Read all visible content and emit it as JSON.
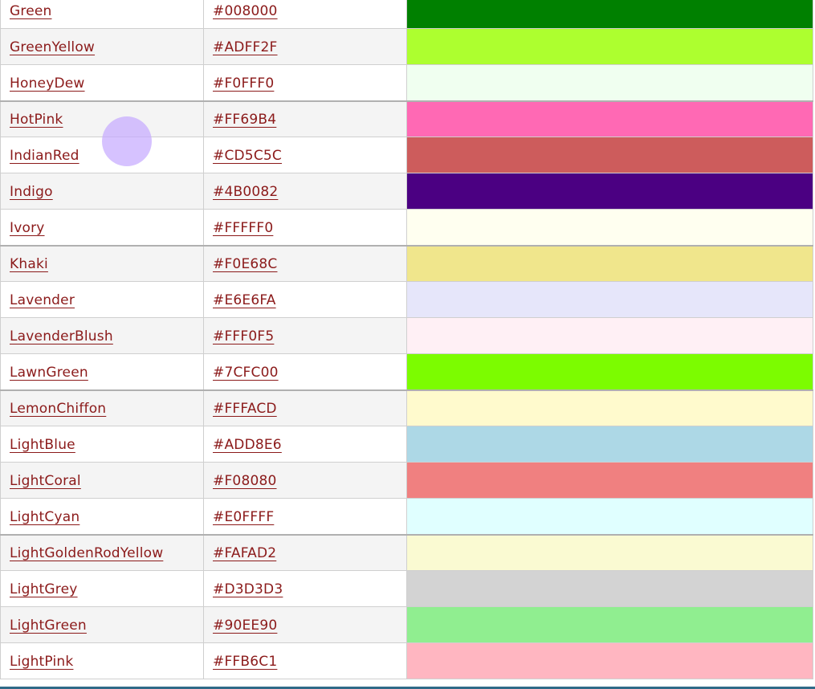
{
  "rows": [
    {
      "name": "Green",
      "hex": "#008000",
      "swatch": "#008000"
    },
    {
      "name": "GreenYellow",
      "hex": "#ADFF2F",
      "swatch": "#ADFF2F"
    },
    {
      "name": "HoneyDew",
      "hex": "#F0FFF0",
      "swatch": "#F0FFF0"
    },
    {
      "name": "HotPink",
      "hex": "#FF69B4",
      "swatch": "#FF69B4"
    },
    {
      "name": "IndianRed",
      "hex": "#CD5C5C",
      "swatch": "#CD5C5C"
    },
    {
      "name": "Indigo",
      "hex": "#4B0082",
      "swatch": "#4B0082"
    },
    {
      "name": "Ivory",
      "hex": "#FFFFF0",
      "swatch": "#FFFFF0"
    },
    {
      "name": "Khaki",
      "hex": "#F0E68C",
      "swatch": "#F0E68C"
    },
    {
      "name": "Lavender",
      "hex": "#E6E6FA",
      "swatch": "#E6E6FA"
    },
    {
      "name": "LavenderBlush",
      "hex": "#FFF0F5",
      "swatch": "#FFF0F5"
    },
    {
      "name": "LawnGreen",
      "hex": "#7CFC00",
      "swatch": "#7CFC00"
    },
    {
      "name": "LemonChiffon",
      "hex": "#FFFACD",
      "swatch": "#FFFACD"
    },
    {
      "name": "LightBlue",
      "hex": "#ADD8E6",
      "swatch": "#ADD8E6"
    },
    {
      "name": "LightCoral",
      "hex": "#F08080",
      "swatch": "#F08080"
    },
    {
      "name": "LightCyan",
      "hex": "#E0FFFF",
      "swatch": "#E0FFFF"
    },
    {
      "name": "LightGoldenRodYellow",
      "hex": "#FAFAD2",
      "swatch": "#FAFAD2"
    },
    {
      "name": "LightGrey",
      "hex": "#D3D3D3",
      "swatch": "#D3D3D3"
    },
    {
      "name": "LightGreen",
      "hex": "#90EE90",
      "swatch": "#90EE90"
    },
    {
      "name": "LightPink",
      "hex": "#FFB6C1",
      "swatch": "#FFB6C1"
    }
  ],
  "colors": {
    "link": "#8B1A1A",
    "row_alt": "#F4F4F4",
    "bottom_bar": "#2F6A88",
    "cursor_highlight": "#C4A8FF"
  }
}
